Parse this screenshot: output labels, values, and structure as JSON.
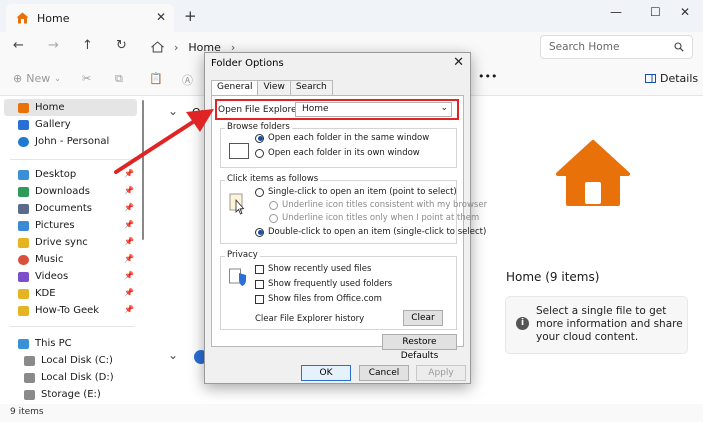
{
  "window": {
    "tab_title": "Home",
    "tab_close": "✕",
    "new_tab": "+",
    "minimize": "—",
    "maximize": "☐",
    "close": "✕"
  },
  "nav": {
    "breadcrumb": "Home",
    "search_placeholder": "Search Home"
  },
  "commandbar": {
    "new_label": "New",
    "more": "•••",
    "details_label": "Details"
  },
  "sidebar": {
    "items": [
      {
        "label": "Home",
        "color": "#e8710a",
        "pinned": false
      },
      {
        "label": "Gallery",
        "color": "#2a6fd6",
        "pinned": false
      },
      {
        "label": "John - Personal",
        "color": "#1f78d1",
        "pinned": false
      },
      {
        "label": "Desktop",
        "color": "#3b8fd6",
        "pinned": true
      },
      {
        "label": "Downloads",
        "color": "#2f9a5a",
        "pinned": true
      },
      {
        "label": "Documents",
        "color": "#5b6c8a",
        "pinned": true
      },
      {
        "label": "Pictures",
        "color": "#3a8ad6",
        "pinned": true
      },
      {
        "label": "Drive sync",
        "color": "#e6b422",
        "pinned": true
      },
      {
        "label": "Music",
        "color": "#d9503f",
        "pinned": true
      },
      {
        "label": "Videos",
        "color": "#7b4fc9",
        "pinned": true
      },
      {
        "label": "KDE",
        "color": "#e6b422",
        "pinned": true
      },
      {
        "label": "How-To Geek",
        "color": "#e6b422",
        "pinned": true
      },
      {
        "label": "This PC",
        "color": "#3b8fd6",
        "pinned": false
      },
      {
        "label": "Local Disk (C:)",
        "color": "#8a8a8a",
        "pinned": false
      },
      {
        "label": "Local Disk (D:)",
        "color": "#8a8a8a",
        "pinned": false
      },
      {
        "label": "Storage (E:)",
        "color": "#8a8a8a",
        "pinned": false
      }
    ]
  },
  "main": {
    "section_peek": "Qu"
  },
  "details": {
    "title": "Home (9 items)",
    "info": "Select a single file to get more information and share your cloud content.",
    "accent": "#e8710a"
  },
  "status": {
    "count": "9 items"
  },
  "dialog": {
    "title": "Folder Options",
    "tabs": [
      "General",
      "View",
      "Search"
    ],
    "open_label": "Open File Explorer to:",
    "open_value": "Home",
    "browse": {
      "legend": "Browse folders",
      "options": [
        "Open each folder in the same window",
        "Open each folder in its own window"
      ]
    },
    "click": {
      "legend": "Click items as follows",
      "single": "Single-click to open an item (point to select)",
      "underline_browser": "Underline icon titles consistent with my browser",
      "underline_point": "Underline icon titles only when I point at them",
      "double": "Double-click to open an item (single-click to select)"
    },
    "privacy": {
      "legend": "Privacy",
      "recent": "Show recently used files",
      "frequent": "Show frequently used folders",
      "office": "Show files from Office.com",
      "clear_label": "Clear File Explorer history",
      "clear_button": "Clear"
    },
    "restore_button": "Restore Defaults",
    "ok": "OK",
    "cancel": "Cancel",
    "apply": "Apply",
    "highlight_color": "#e02424"
  }
}
